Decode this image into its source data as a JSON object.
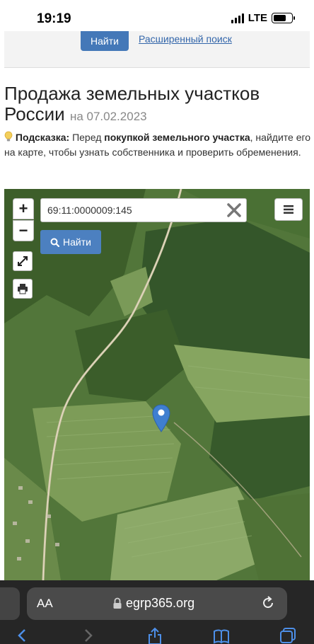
{
  "status_bar": {
    "time": "19:19",
    "network": "LTE",
    "battery_level": 0.7
  },
  "search_band": {
    "find_label": "Найти",
    "advanced_link": "Расширенный поиск"
  },
  "page": {
    "title": "Продажа земельных участков России",
    "date": "на 07.02.2023"
  },
  "hint": {
    "label": "Подсказка:",
    "text_before": "Перед",
    "bold": "покупкой земельного участка",
    "text_after": ", найдите его на карте, чтобы узнать собственника и проверить обременения."
  },
  "map": {
    "zoom_in": "+",
    "zoom_out": "−",
    "search_value": "69:11:0000009:145",
    "find_label": "Найти",
    "pin_color": "#3f7fd0"
  },
  "browser": {
    "aa_label": "AA",
    "url": "egrp365.org"
  },
  "colors": {
    "accent": "#4478b8",
    "link": "#3366aa",
    "browser_bg": "#262626"
  }
}
